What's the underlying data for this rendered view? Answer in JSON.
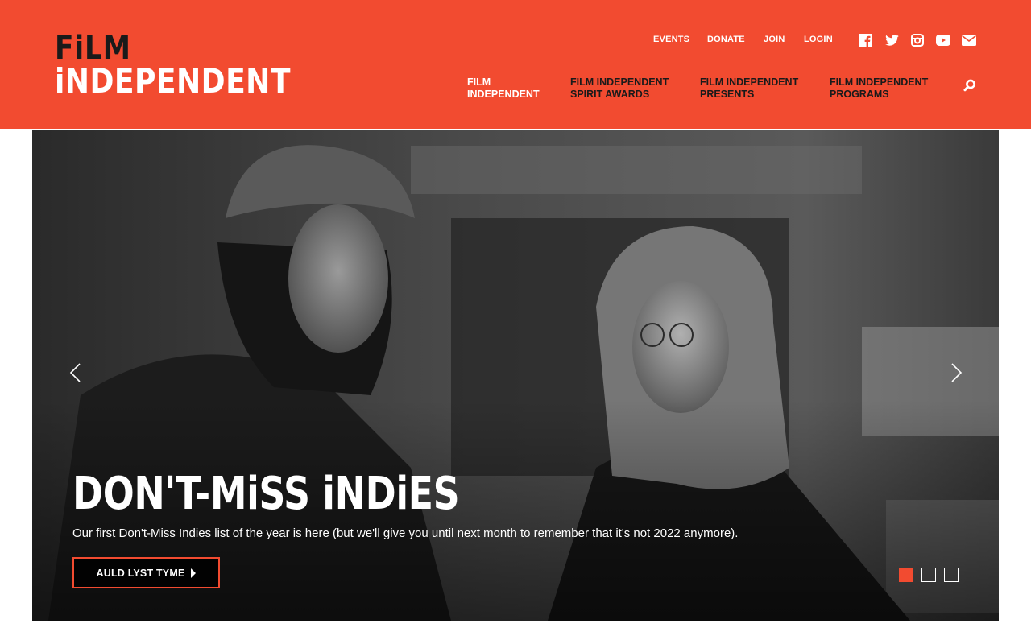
{
  "brand": {
    "logo_line1": "FiLM",
    "logo_line2": "iNDEPENDENT",
    "accent_color": "#f24b30"
  },
  "utility_nav": [
    {
      "label": "EVENTS"
    },
    {
      "label": "DONATE"
    },
    {
      "label": "JOIN"
    },
    {
      "label": "LOGIN"
    }
  ],
  "social_icons": [
    "facebook-icon",
    "twitter-icon",
    "instagram-icon",
    "youtube-icon",
    "email-icon"
  ],
  "main_nav": [
    {
      "line1": "FILM",
      "line2": "INDEPENDENT"
    },
    {
      "line1": "FILM INDEPENDENT",
      "line2": "SPIRIT AWARDS"
    },
    {
      "line1": "FILM INDEPENDENT",
      "line2": "PRESENTS"
    },
    {
      "line1": "FILM INDEPENDENT",
      "line2": "PROGRAMS"
    }
  ],
  "hero": {
    "title": "DON'T-MiSS iNDiES",
    "subtitle": "Our first Don't-Miss Indies list of the year is here (but we'll give you until next month to remember that it's not 2022 anymore).",
    "cta_label": "AULD LYST TYME",
    "slide_count": 3,
    "active_slide": 1
  }
}
